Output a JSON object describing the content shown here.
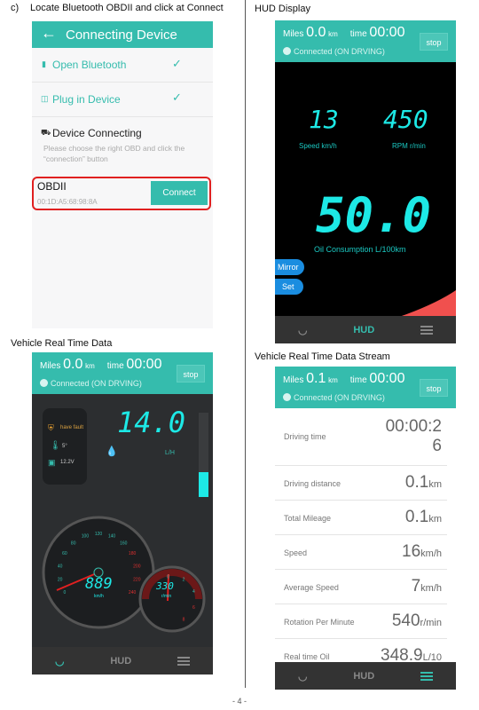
{
  "steps": {
    "c": {
      "marker": "c)",
      "text": "Locate Bluetooth OBDII and click at Connect"
    }
  },
  "connect_screen": {
    "title": "Connecting Device",
    "items": [
      {
        "label": "Open Bluetooth",
        "icon": "bluetooth-icon",
        "done": true
      },
      {
        "label": "Plug in Device",
        "icon": "plug-icon",
        "done": true
      }
    ],
    "device_connecting": {
      "title": "Device Connecting",
      "description": "Please choose the right OBD and click the “connection” button"
    },
    "device": {
      "name": "OBDII",
      "address": "00:1D:A5:68:98:8A",
      "button": "Connect"
    },
    "highlight_color": "#e02020"
  },
  "captions": {
    "hud": "HUD Display",
    "realtime": "Vehicle Real Time Data",
    "stream": "Vehicle Real Time Data Stream"
  },
  "hud_screen": {
    "header": {
      "miles_label": "Miles",
      "miles": "0.0",
      "miles_unit": "km",
      "time_label": "time",
      "time": "00:00",
      "stop": "stop",
      "status": "Connected (ON DRVING)"
    },
    "speed": "13",
    "speed_label": "Speed km/h",
    "rpm": "450",
    "rpm_label": "RPM r/min",
    "oil": "50.0",
    "oil_label": "Oil Consumption L/100km",
    "mirror": "Mirror",
    "set": "Set",
    "nav": {
      "hud": "HUD"
    }
  },
  "realtime_screen": {
    "header": {
      "miles_label": "Miles",
      "miles": "0.0",
      "miles_unit": "km",
      "time_label": "time",
      "time": "00:00",
      "stop": "stop",
      "status": "Connected (ON DRVING)"
    },
    "fault": "have fault",
    "temp": "5°",
    "voltage": "12.2V",
    "fuel_rate": "14.0",
    "fuel_unit": "L/H",
    "speed_ticks": [
      "0",
      "20",
      "40",
      "60",
      "80",
      "100",
      "120",
      "140",
      "160",
      "180",
      "200",
      "220",
      "240"
    ],
    "speed_display": "889",
    "speed_unit": "km/h",
    "rpm_ticks": [
      "0",
      "2",
      "4",
      "6",
      "8"
    ],
    "rpm": "330",
    "rpm_unit": "r/min",
    "level_fraction": 0.3,
    "nav": {
      "hud": "HUD"
    }
  },
  "stream_screen": {
    "header": {
      "miles_label": "Miles",
      "miles": "0.1",
      "miles_unit": "km",
      "time_label": "time",
      "time": "00:00",
      "stop": "stop",
      "status": "Connected (ON DRVING)"
    },
    "rows": [
      {
        "label": "Driving time",
        "value": "00:00:2",
        "value2": "6",
        "unit": ""
      },
      {
        "label": "Driving distance",
        "value": "0.1",
        "unit": "km"
      },
      {
        "label": "Total Mileage",
        "value": "0.1",
        "unit": "km"
      },
      {
        "label": "Speed",
        "value": "16",
        "unit": "km/h"
      },
      {
        "label": "Average Speed",
        "value": "7",
        "unit": "km/h"
      },
      {
        "label": "Rotation Per Minute",
        "value": "540",
        "unit": "r/min"
      },
      {
        "label": "Real time Oil",
        "value": "348.9",
        "unit": "L/10"
      }
    ],
    "nav": {
      "hud": "HUD"
    }
  },
  "page_number": "- 4 -"
}
